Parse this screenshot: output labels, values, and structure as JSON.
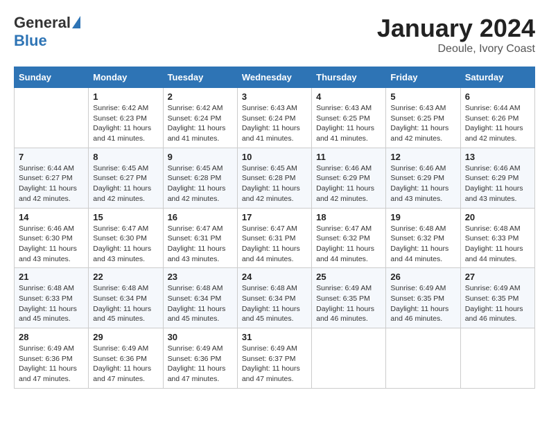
{
  "header": {
    "logo_general": "General",
    "logo_blue": "Blue",
    "title": "January 2024",
    "location": "Deoule, Ivory Coast"
  },
  "days_of_week": [
    "Sunday",
    "Monday",
    "Tuesday",
    "Wednesday",
    "Thursday",
    "Friday",
    "Saturday"
  ],
  "weeks": [
    [
      {
        "day": "",
        "sunrise": "",
        "sunset": "",
        "daylight": ""
      },
      {
        "day": "1",
        "sunrise": "Sunrise: 6:42 AM",
        "sunset": "Sunset: 6:23 PM",
        "daylight": "Daylight: 11 hours and 41 minutes."
      },
      {
        "day": "2",
        "sunrise": "Sunrise: 6:42 AM",
        "sunset": "Sunset: 6:24 PM",
        "daylight": "Daylight: 11 hours and 41 minutes."
      },
      {
        "day": "3",
        "sunrise": "Sunrise: 6:43 AM",
        "sunset": "Sunset: 6:24 PM",
        "daylight": "Daylight: 11 hours and 41 minutes."
      },
      {
        "day": "4",
        "sunrise": "Sunrise: 6:43 AM",
        "sunset": "Sunset: 6:25 PM",
        "daylight": "Daylight: 11 hours and 41 minutes."
      },
      {
        "day": "5",
        "sunrise": "Sunrise: 6:43 AM",
        "sunset": "Sunset: 6:25 PM",
        "daylight": "Daylight: 11 hours and 42 minutes."
      },
      {
        "day": "6",
        "sunrise": "Sunrise: 6:44 AM",
        "sunset": "Sunset: 6:26 PM",
        "daylight": "Daylight: 11 hours and 42 minutes."
      }
    ],
    [
      {
        "day": "7",
        "sunrise": "Sunrise: 6:44 AM",
        "sunset": "Sunset: 6:27 PM",
        "daylight": "Daylight: 11 hours and 42 minutes."
      },
      {
        "day": "8",
        "sunrise": "Sunrise: 6:45 AM",
        "sunset": "Sunset: 6:27 PM",
        "daylight": "Daylight: 11 hours and 42 minutes."
      },
      {
        "day": "9",
        "sunrise": "Sunrise: 6:45 AM",
        "sunset": "Sunset: 6:28 PM",
        "daylight": "Daylight: 11 hours and 42 minutes."
      },
      {
        "day": "10",
        "sunrise": "Sunrise: 6:45 AM",
        "sunset": "Sunset: 6:28 PM",
        "daylight": "Daylight: 11 hours and 42 minutes."
      },
      {
        "day": "11",
        "sunrise": "Sunrise: 6:46 AM",
        "sunset": "Sunset: 6:29 PM",
        "daylight": "Daylight: 11 hours and 42 minutes."
      },
      {
        "day": "12",
        "sunrise": "Sunrise: 6:46 AM",
        "sunset": "Sunset: 6:29 PM",
        "daylight": "Daylight: 11 hours and 43 minutes."
      },
      {
        "day": "13",
        "sunrise": "Sunrise: 6:46 AM",
        "sunset": "Sunset: 6:29 PM",
        "daylight": "Daylight: 11 hours and 43 minutes."
      }
    ],
    [
      {
        "day": "14",
        "sunrise": "Sunrise: 6:46 AM",
        "sunset": "Sunset: 6:30 PM",
        "daylight": "Daylight: 11 hours and 43 minutes."
      },
      {
        "day": "15",
        "sunrise": "Sunrise: 6:47 AM",
        "sunset": "Sunset: 6:30 PM",
        "daylight": "Daylight: 11 hours and 43 minutes."
      },
      {
        "day": "16",
        "sunrise": "Sunrise: 6:47 AM",
        "sunset": "Sunset: 6:31 PM",
        "daylight": "Daylight: 11 hours and 43 minutes."
      },
      {
        "day": "17",
        "sunrise": "Sunrise: 6:47 AM",
        "sunset": "Sunset: 6:31 PM",
        "daylight": "Daylight: 11 hours and 44 minutes."
      },
      {
        "day": "18",
        "sunrise": "Sunrise: 6:47 AM",
        "sunset": "Sunset: 6:32 PM",
        "daylight": "Daylight: 11 hours and 44 minutes."
      },
      {
        "day": "19",
        "sunrise": "Sunrise: 6:48 AM",
        "sunset": "Sunset: 6:32 PM",
        "daylight": "Daylight: 11 hours and 44 minutes."
      },
      {
        "day": "20",
        "sunrise": "Sunrise: 6:48 AM",
        "sunset": "Sunset: 6:33 PM",
        "daylight": "Daylight: 11 hours and 44 minutes."
      }
    ],
    [
      {
        "day": "21",
        "sunrise": "Sunrise: 6:48 AM",
        "sunset": "Sunset: 6:33 PM",
        "daylight": "Daylight: 11 hours and 45 minutes."
      },
      {
        "day": "22",
        "sunrise": "Sunrise: 6:48 AM",
        "sunset": "Sunset: 6:34 PM",
        "daylight": "Daylight: 11 hours and 45 minutes."
      },
      {
        "day": "23",
        "sunrise": "Sunrise: 6:48 AM",
        "sunset": "Sunset: 6:34 PM",
        "daylight": "Daylight: 11 hours and 45 minutes."
      },
      {
        "day": "24",
        "sunrise": "Sunrise: 6:48 AM",
        "sunset": "Sunset: 6:34 PM",
        "daylight": "Daylight: 11 hours and 45 minutes."
      },
      {
        "day": "25",
        "sunrise": "Sunrise: 6:49 AM",
        "sunset": "Sunset: 6:35 PM",
        "daylight": "Daylight: 11 hours and 46 minutes."
      },
      {
        "day": "26",
        "sunrise": "Sunrise: 6:49 AM",
        "sunset": "Sunset: 6:35 PM",
        "daylight": "Daylight: 11 hours and 46 minutes."
      },
      {
        "day": "27",
        "sunrise": "Sunrise: 6:49 AM",
        "sunset": "Sunset: 6:35 PM",
        "daylight": "Daylight: 11 hours and 46 minutes."
      }
    ],
    [
      {
        "day": "28",
        "sunrise": "Sunrise: 6:49 AM",
        "sunset": "Sunset: 6:36 PM",
        "daylight": "Daylight: 11 hours and 47 minutes."
      },
      {
        "day": "29",
        "sunrise": "Sunrise: 6:49 AM",
        "sunset": "Sunset: 6:36 PM",
        "daylight": "Daylight: 11 hours and 47 minutes."
      },
      {
        "day": "30",
        "sunrise": "Sunrise: 6:49 AM",
        "sunset": "Sunset: 6:36 PM",
        "daylight": "Daylight: 11 hours and 47 minutes."
      },
      {
        "day": "31",
        "sunrise": "Sunrise: 6:49 AM",
        "sunset": "Sunset: 6:37 PM",
        "daylight": "Daylight: 11 hours and 47 minutes."
      },
      {
        "day": "",
        "sunrise": "",
        "sunset": "",
        "daylight": ""
      },
      {
        "day": "",
        "sunrise": "",
        "sunset": "",
        "daylight": ""
      },
      {
        "day": "",
        "sunrise": "",
        "sunset": "",
        "daylight": ""
      }
    ]
  ]
}
